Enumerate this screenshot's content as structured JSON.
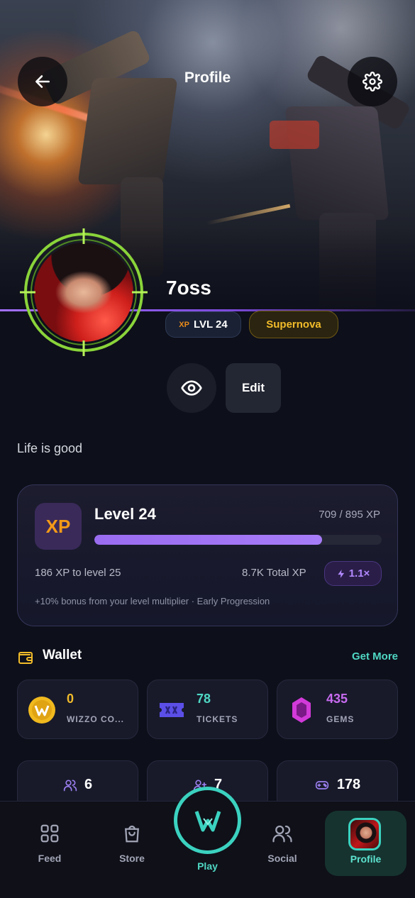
{
  "header": {
    "title": "Profile",
    "back_icon": "arrow-left-icon",
    "settings_icon": "gear-icon"
  },
  "profile": {
    "username": "7oss",
    "level_badge": {
      "prefix": "XP",
      "label": "LVL 24"
    },
    "tier_badge": "Supernova",
    "edit_label": "Edit",
    "view_icon": "eye-icon",
    "bio": "Life is good"
  },
  "level_card": {
    "tile": "XP",
    "title": "Level 24",
    "xp_progress": "709 / 895 XP",
    "progress_fraction": 0.792,
    "to_next": "186 XP to level 25",
    "total_xp": "8.7K Total XP",
    "multiplier": "1.1×",
    "bonus_text": "+10% bonus from your level multiplier · Early Progression"
  },
  "wallet": {
    "title": "Wallet",
    "get_more": "Get More",
    "items": [
      {
        "value": "0",
        "label": "WIZZO CO...",
        "icon": "wizzo-coin-icon",
        "color": "#f0b91e"
      },
      {
        "value": "78",
        "label": "TICKETS",
        "icon": "ticket-icon",
        "color": "#5b4fe8"
      },
      {
        "value": "435",
        "label": "GEMS",
        "icon": "gem-icon",
        "color": "#d23ad9"
      }
    ]
  },
  "stats": [
    {
      "value": "6",
      "icon": "users-icon"
    },
    {
      "value": "7",
      "icon": "user-plus-icon"
    },
    {
      "value": "178",
      "icon": "gamepad-icon"
    }
  ],
  "nav": {
    "feed": "Feed",
    "store": "Store",
    "play": "Play",
    "social": "Social",
    "profile": "Profile"
  },
  "colors": {
    "accent_teal": "#3bd2c0",
    "accent_purple": "#a270ff",
    "tier_gold": "#f2bc2a",
    "xp_orange": "#f39a18",
    "background": "#0d0f1a"
  }
}
